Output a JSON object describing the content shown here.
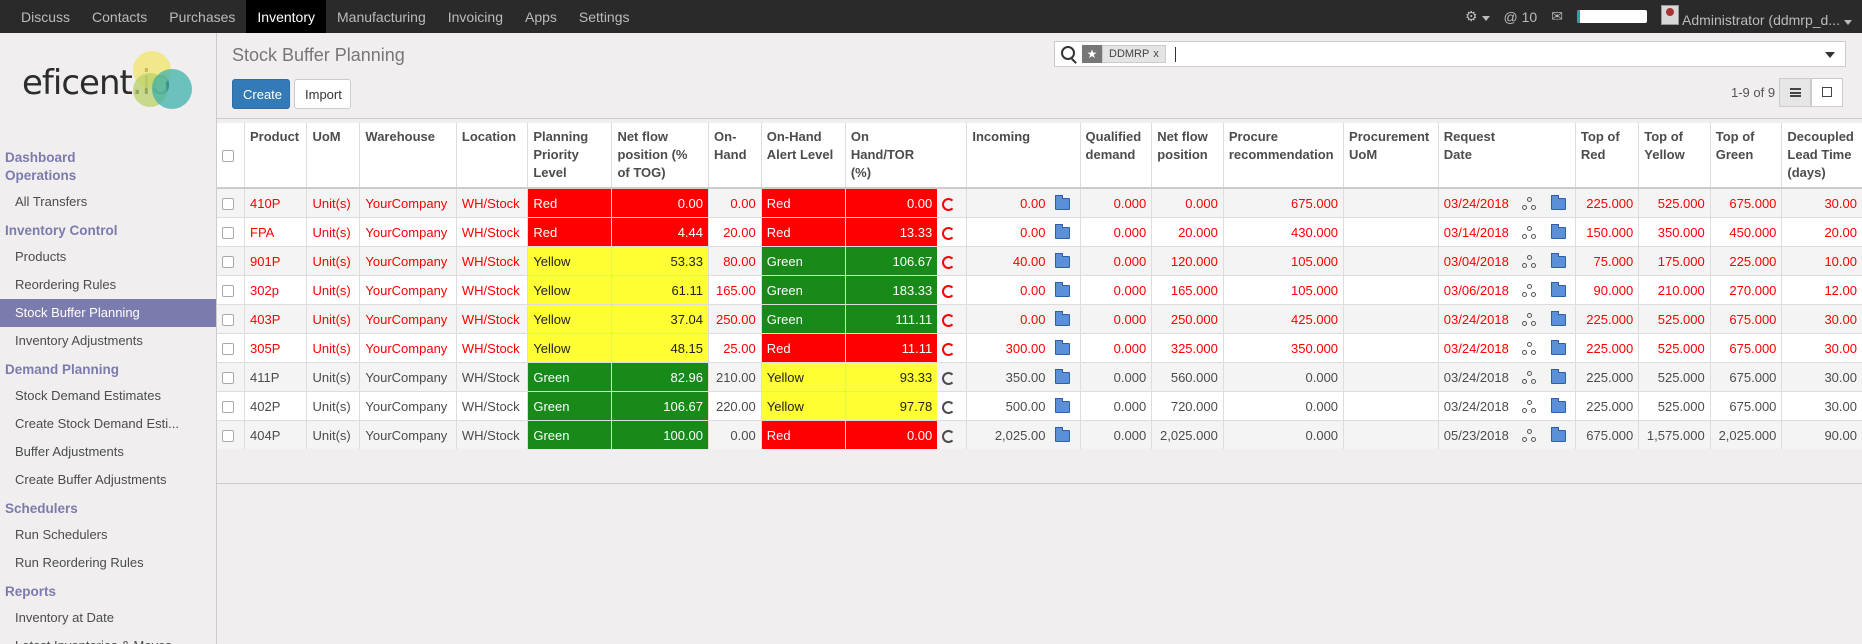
{
  "topbar": {
    "menu": [
      "Discuss",
      "Contacts",
      "Purchases",
      "Inventory",
      "Manufacturing",
      "Invoicing",
      "Apps",
      "Settings"
    ],
    "active": "Inventory",
    "mentions": "10",
    "user": "Administrator (ddmrp_d..."
  },
  "sidebar": {
    "logo": "eficent.io",
    "sections": [
      {
        "title": "Dashboard Operations",
        "items": [
          "All Transfers"
        ]
      },
      {
        "title": "Inventory Control",
        "items": [
          "Products",
          "Reordering Rules",
          "Stock Buffer Planning",
          "Inventory Adjustments"
        ]
      },
      {
        "title": "Demand Planning",
        "items": [
          "Stock Demand Estimates",
          "Create Stock Demand Esti...",
          "Buffer Adjustments",
          "Create Buffer Adjustments"
        ]
      },
      {
        "title": "Schedulers",
        "items": [
          "Run Schedulers",
          "Run Reordering Rules"
        ]
      },
      {
        "title": "Reports",
        "items": [
          "Inventory at Date",
          "Latest Inventories & Moves"
        ]
      }
    ],
    "active_item": "Stock Buffer Planning"
  },
  "control_panel": {
    "title": "Stock Buffer Planning",
    "create_label": "Create",
    "import_label": "Import",
    "search_facet": "DDMRP",
    "pager": "1-9 of 9"
  },
  "table": {
    "headers": [
      "Product",
      "UoM",
      "Warehouse",
      "Location",
      "Planning Priority Level",
      "Net flow position (% of TOG)",
      "On-Hand",
      "On-Hand Alert Level",
      "On Hand/TOR (%)",
      "",
      "Incoming",
      "",
      "Qualified demand",
      "Net flow position",
      "Procure recommendation",
      "Procurement UoM",
      "Request Date",
      "",
      "",
      "Top of Red",
      "Top of Yellow",
      "Top of Green",
      "Decoupled Lead Time (days)"
    ],
    "rows": [
      {
        "style": "red",
        "product": "410P",
        "uom": "Unit(s)",
        "wh": "YourCompany",
        "loc": "WH/Stock",
        "ppl": "Red",
        "ppl_c": "red",
        "nfp_pct": "0.00",
        "onhand": "0.00",
        "ohal": "Red",
        "ohal_c": "red",
        "ohtor": "0.00",
        "incoming": "0.00",
        "qd": "0.000",
        "nfp": "0.000",
        "proc": "675.000",
        "puom": "",
        "date": "03/24/2018",
        "tor": "225.000",
        "toy": "525.000",
        "tog": "675.000",
        "dlt": "30.00"
      },
      {
        "style": "red",
        "product": "FPA",
        "uom": "Unit(s)",
        "wh": "YourCompany",
        "loc": "WH/Stock",
        "ppl": "Red",
        "ppl_c": "red",
        "nfp_pct": "4.44",
        "onhand": "20.00",
        "ohal": "Red",
        "ohal_c": "red",
        "ohtor": "13.33",
        "incoming": "0.00",
        "qd": "0.000",
        "nfp": "20.000",
        "proc": "430.000",
        "puom": "",
        "date": "03/14/2018",
        "tor": "150.000",
        "toy": "350.000",
        "tog": "450.000",
        "dlt": "20.00"
      },
      {
        "style": "red",
        "product": "901P",
        "uom": "Unit(s)",
        "wh": "YourCompany",
        "loc": "WH/Stock",
        "ppl": "Yellow",
        "ppl_c": "yellow",
        "nfp_pct": "53.33",
        "onhand": "80.00",
        "ohal": "Green",
        "ohal_c": "green",
        "ohtor": "106.67",
        "incoming": "40.00",
        "qd": "0.000",
        "nfp": "120.000",
        "proc": "105.000",
        "puom": "",
        "date": "03/04/2018",
        "tor": "75.000",
        "toy": "175.000",
        "tog": "225.000",
        "dlt": "10.00"
      },
      {
        "style": "red",
        "product": "302p",
        "uom": "Unit(s)",
        "wh": "YourCompany",
        "loc": "WH/Stock",
        "ppl": "Yellow",
        "ppl_c": "yellow",
        "nfp_pct": "61.11",
        "onhand": "165.00",
        "ohal": "Green",
        "ohal_c": "green",
        "ohtor": "183.33",
        "incoming": "0.00",
        "qd": "0.000",
        "nfp": "165.000",
        "proc": "105.000",
        "puom": "",
        "date": "03/06/2018",
        "tor": "90.000",
        "toy": "210.000",
        "tog": "270.000",
        "dlt": "12.00"
      },
      {
        "style": "red",
        "product": "403P",
        "uom": "Unit(s)",
        "wh": "YourCompany",
        "loc": "WH/Stock",
        "ppl": "Yellow",
        "ppl_c": "yellow",
        "nfp_pct": "37.04",
        "onhand": "250.00",
        "ohal": "Green",
        "ohal_c": "green",
        "ohtor": "111.11",
        "incoming": "0.00",
        "qd": "0.000",
        "nfp": "250.000",
        "proc": "425.000",
        "puom": "",
        "date": "03/24/2018",
        "tor": "225.000",
        "toy": "525.000",
        "tog": "675.000",
        "dlt": "30.00"
      },
      {
        "style": "red",
        "product": "305P",
        "uom": "Unit(s)",
        "wh": "YourCompany",
        "loc": "WH/Stock",
        "ppl": "Yellow",
        "ppl_c": "yellow",
        "nfp_pct": "48.15",
        "onhand": "25.00",
        "ohal": "Red",
        "ohal_c": "red",
        "ohtor": "11.11",
        "incoming": "300.00",
        "qd": "0.000",
        "nfp": "325.000",
        "proc": "350.000",
        "puom": "",
        "date": "03/24/2018",
        "tor": "225.000",
        "toy": "525.000",
        "tog": "675.000",
        "dlt": "30.00"
      },
      {
        "style": "norm",
        "product": "411P",
        "uom": "Unit(s)",
        "wh": "YourCompany",
        "loc": "WH/Stock",
        "ppl": "Green",
        "ppl_c": "green",
        "nfp_pct": "82.96",
        "onhand": "210.00",
        "ohal": "Yellow",
        "ohal_c": "yellow",
        "ohtor": "93.33",
        "incoming": "350.00",
        "qd": "0.000",
        "nfp": "560.000",
        "proc": "0.000",
        "puom": "",
        "date": "03/24/2018",
        "tor": "225.000",
        "toy": "525.000",
        "tog": "675.000",
        "dlt": "30.00"
      },
      {
        "style": "norm",
        "product": "402P",
        "uom": "Unit(s)",
        "wh": "YourCompany",
        "loc": "WH/Stock",
        "ppl": "Green",
        "ppl_c": "green",
        "nfp_pct": "106.67",
        "onhand": "220.00",
        "ohal": "Yellow",
        "ohal_c": "yellow",
        "ohtor": "97.78",
        "incoming": "500.00",
        "qd": "0.000",
        "nfp": "720.000",
        "proc": "0.000",
        "puom": "",
        "date": "03/24/2018",
        "tor": "225.000",
        "toy": "525.000",
        "tog": "675.000",
        "dlt": "30.00"
      },
      {
        "style": "norm",
        "product": "404P",
        "uom": "Unit(s)",
        "wh": "YourCompany",
        "loc": "WH/Stock",
        "ppl": "Green",
        "ppl_c": "green",
        "nfp_pct": "100.00",
        "onhand": "0.00",
        "ohal": "Red",
        "ohal_c": "red",
        "ohtor": "0.00",
        "incoming": "2,025.00",
        "qd": "0.000",
        "nfp": "2,025.000",
        "proc": "0.000",
        "puom": "",
        "date": "05/23/2018",
        "tor": "675.000",
        "toy": "1,575.000",
        "tog": "2,025.000",
        "dlt": "90.00"
      }
    ]
  },
  "colors": {
    "red": "#ff0000",
    "yellow": "#ffff33",
    "green": "#188a1a",
    "accent": "#7c7bad",
    "primary": "#337ab7"
  },
  "status": {
    "progress": 0.05
  }
}
